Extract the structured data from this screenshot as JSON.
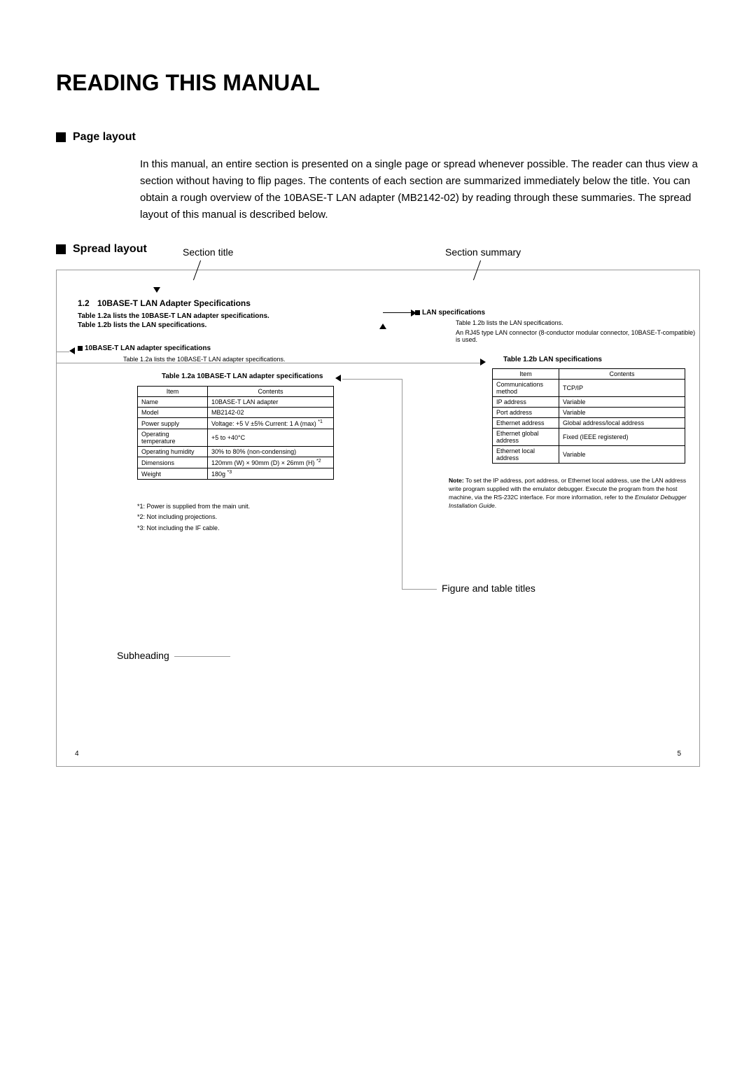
{
  "title": "READING THIS MANUAL",
  "section_page_layout": "Page layout",
  "section_spread_layout": "Spread layout",
  "body": "In this manual, an entire section is presented on a single page or spread whenever possible. The reader can thus view a section without having to flip pages. The contents of each section are summarized immediately below the title.  You can obtain a rough overview of the 10BASE-T LAN adapter (MB2142-02) by reading through these summaries. The spread layout of this manual is described below.",
  "labels": {
    "section_title": "Section title",
    "section_summary": "Section summary",
    "figure_table_titles": "Figure and table titles",
    "subheading": "Subheading"
  },
  "doc": {
    "sec_num": "1.2",
    "sec_title": "10BASE-T LAN Adapter Specifications",
    "summary1": "Table 1.2a lists the 10BASE-T LAN adapter specifications.",
    "summary2": "Table 1.2b lists the LAN specifications.",
    "lan_spec_heading": "LAN specifications",
    "lan_text1": "Table 1.2b lists the LAN specifications.",
    "lan_text2": "An RJ45 type LAN connector (8-conductor modular connector, 10BASE-T-compatible) is used.",
    "sub1": "10BASE-T LAN adapter specifications",
    "sub1_text": "Table 1.2a lists the 10BASE-T LAN adapter specifications.",
    "table1_title": "Table 1.2a  10BASE-T LAN adapter specifications",
    "table2_title": "Table 1.2b  LAN specifications",
    "tbl1_h1": "Item",
    "tbl1_h2": "Contents",
    "tbl1_r1c1": "Name",
    "tbl1_r1c2": "10BASE-T LAN adapter",
    "tbl1_r2c1": "Model",
    "tbl1_r2c2": "MB2142-02",
    "tbl1_r3c1": "Power supply",
    "tbl1_r3c2": "Voltage: +5 V ±5% Current: 1 A (max) ",
    "tbl1_r3c2_sup": "*1",
    "tbl1_r4c1": "Operating temperature",
    "tbl1_r4c2": "+5 to +40°C",
    "tbl1_r5c1": "Operating humidity",
    "tbl1_r5c2": "30% to 80% (non-condensing)",
    "tbl1_r6c1": "Dimensions",
    "tbl1_r6c2": "120mm (W) × 90mm (D) × 26mm (H) ",
    "tbl1_r6c2_sup": "*2",
    "tbl1_r7c1": "Weight",
    "tbl1_r7c2": "180g ",
    "tbl1_r7c2_sup": "*3",
    "fn1": "*1: Power is supplied from the main unit.",
    "fn2": "*2: Not including projections.",
    "fn3": "*3: Not including the IF cable.",
    "tbl2_h1": "Item",
    "tbl2_h2": "Contents",
    "tbl2_r1c1": "Communications method",
    "tbl2_r1c2": "TCP/IP",
    "tbl2_r2c1": "IP address",
    "tbl2_r2c2": "Variable",
    "tbl2_r3c1": "Port address",
    "tbl2_r3c2": "Variable",
    "tbl2_r4c1": "Ethernet address",
    "tbl2_r4c2": "Global address/local address",
    "tbl2_r5c1": "Ethernet global address",
    "tbl2_r5c2": "Fixed (IEEE registered)",
    "tbl2_r6c1": "Ethernet local address",
    "tbl2_r6c2": "Variable",
    "note_bold": "Note: ",
    "note_text": "To set the IP address, port address, or Ethernet local address, use the LAN address write program supplied with the emulator debugger. Execute the program from the host machine, via the RS-232C interface. For more information, refer to the ",
    "note_italic": "Emulator Debugger Installation Guide",
    "note_end": ".",
    "page_left": "4",
    "page_right": "5"
  }
}
